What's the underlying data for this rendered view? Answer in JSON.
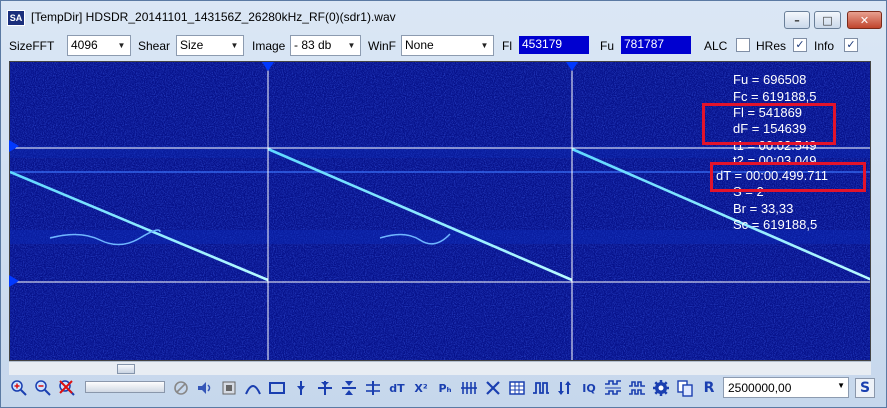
{
  "window": {
    "app_icon": "SA",
    "title": "[TempDir] HDSDR_20141101_143156Z_26280kHz_RF(0)(sdr1).wav",
    "min_glyph": "–",
    "max_glyph": "□",
    "close_glyph": "✕"
  },
  "toolbar": {
    "sizefft_label": "SizeFFT",
    "sizefft_value": "4096",
    "shear_label": "Shear",
    "shear_value": "Size",
    "image_label": "Image",
    "image_value": "- 83 db",
    "winf_label": "WinF",
    "winf_value": "None",
    "fl_label": "Fl",
    "fl_value": "453179",
    "fu_label": "Fu",
    "fu_value": "781787",
    "alc_label": "ALC",
    "alc_checked": false,
    "hres_label": "HRes",
    "hres_checked": true,
    "info_label": "Info",
    "info_checked": true,
    "dropdown_glyph": "▼",
    "check_glyph": "✓"
  },
  "info_panel": {
    "fu": "Fu = 696508",
    "fc": "Fc = 619188,5",
    "fl": "Fl = 541869",
    "df": "dF = 154639",
    "t1": "t1 = 00:02.549",
    "t2": "t2 = 00:03.049",
    "dt": "dT = 00:00.499.711",
    "s": "S = 2",
    "br": "Br = 33,33",
    "sc": "Sc = 619188,5"
  },
  "colors": {
    "spectrogram_bg": "#06118a",
    "signal": "#7fe8ff",
    "cursor_lines": "#ffffff",
    "highlight": "#e3132b",
    "value_box": "#0000d0"
  },
  "bottombar": {
    "frequency_value": "2500000,00",
    "icons": [
      "zoom-in-icon",
      "zoom-out-icon",
      "zoom-cancel-icon",
      "no-entry-icon",
      "speaker-icon",
      "stop-icon",
      "arc-icon",
      "rectangle-icon",
      "marker-down-icon",
      "marker-split-icon",
      "marker-both-icon",
      "marker-triple-icon",
      "dt-icon",
      "x-squared-icon",
      "p-h-icon",
      "grid-lines-icon",
      "cross-icon",
      "table-icon",
      "pulse-icon",
      "sort-icon",
      "iq-icon",
      "wave-grid-icon",
      "comb-icon",
      "gear-icon",
      "copy-icon",
      "r-icon",
      "s-icon"
    ],
    "glyphs": {
      "dt": "dT",
      "xsq": "X²",
      "ph": "Pₕ",
      "iq": "IQ",
      "r": "R",
      "s": "S"
    }
  }
}
